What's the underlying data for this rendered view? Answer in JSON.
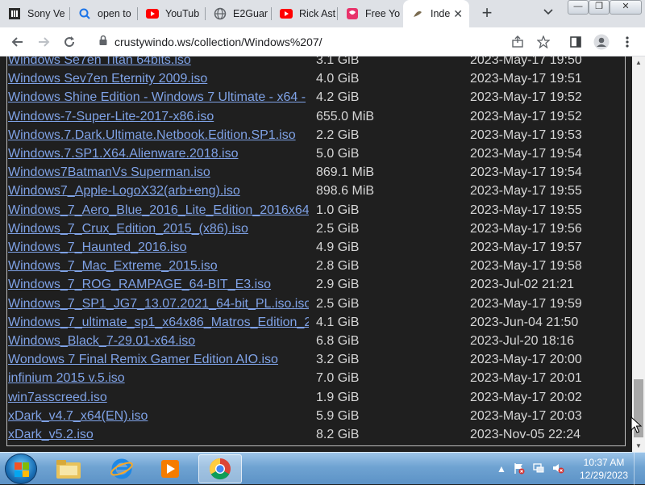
{
  "tabs": [
    {
      "title": "Sony Ve",
      "icon": "sony-icon"
    },
    {
      "title": "open to",
      "icon": "search-icon"
    },
    {
      "title": "YouTub",
      "icon": "youtube-icon"
    },
    {
      "title": "E2Guar",
      "icon": "globe-icon"
    },
    {
      "title": "Rick Ast",
      "icon": "youtube-icon"
    },
    {
      "title": "Free Yo",
      "icon": "freeyo-icon"
    },
    {
      "title": "Inde",
      "icon": "page-icon",
      "active": true
    }
  ],
  "new_tab_label": "+",
  "address_bar": {
    "url": "crustywindo.ws/collection/Windows%207/"
  },
  "files": [
    {
      "name": "Windows Se7en Titan 64bits.iso",
      "size": "3.1 GiB",
      "date": "2023-May-17 19:50"
    },
    {
      "name": "Windows Sev7en Eternity 2009.iso",
      "size": "4.0 GiB",
      "date": "2023-May-17 19:51"
    },
    {
      "name": "Windows Shine Edition - Windows 7 Ultimate - x64 - ",
      "size": "4.2 GiB",
      "date": "2023-May-17 19:52"
    },
    {
      "name": "Windows-7-Super-Lite-2017-x86.iso",
      "size": "655.0 MiB",
      "date": "2023-May-17 19:52"
    },
    {
      "name": "Windows.7.Dark.Ultimate.Netbook.Edition.SP1.iso",
      "size": "2.2 GiB",
      "date": "2023-May-17 19:53"
    },
    {
      "name": "Windows.7.SP1.X64.Alienware.2018.iso",
      "size": "5.0 GiB",
      "date": "2023-May-17 19:54"
    },
    {
      "name": "Windows7BatmanVs Superman.iso",
      "size": "869.1 MiB",
      "date": "2023-May-17 19:54"
    },
    {
      "name": "Windows7_Apple-LogoX32(arb+eng).iso",
      "size": "898.6 MiB",
      "date": "2023-May-17 19:55"
    },
    {
      "name": "Windows_7_Aero_Blue_2016_Lite_Edition_2016x64",
      "size": "1.0 GiB",
      "date": "2023-May-17 19:55"
    },
    {
      "name": "Windows_7_Crux_Edition_2015_(x86).iso",
      "size": "2.5 GiB",
      "date": "2023-May-17 19:56"
    },
    {
      "name": "Windows_7_Haunted_2016.iso",
      "size": "4.9 GiB",
      "date": "2023-May-17 19:57"
    },
    {
      "name": "Windows_7_Mac_Extreme_2015.iso",
      "size": "2.8 GiB",
      "date": "2023-May-17 19:58"
    },
    {
      "name": "Windows_7_ROG_RAMPAGE_64-BIT_E3.iso",
      "size": "2.9 GiB",
      "date": "2023-Jul-02 21:21"
    },
    {
      "name": "Windows_7_SP1_JG7_13.07.2021_64-bit_PL.iso.iso",
      "size": "2.5 GiB",
      "date": "2023-May-17 19:59"
    },
    {
      "name": "Windows_7_ultimate_sp1_x64x86_Matros_Edition_2",
      "size": "4.1 GiB",
      "date": "2023-Jun-04 21:50"
    },
    {
      "name": "Windows_Black_7-29.01-x64.iso",
      "size": "6.8 GiB",
      "date": "2023-Jul-20 18:16"
    },
    {
      "name": "Wondows 7 Final Remix Gamer Edition AIO.iso",
      "size": "3.2 GiB",
      "date": "2023-May-17 20:00"
    },
    {
      "name": "infinium 2015 v.5.iso",
      "size": "7.0 GiB",
      "date": "2023-May-17 20:01"
    },
    {
      "name": "win7asscreed.iso",
      "size": "1.9 GiB",
      "date": "2023-May-17 20:02"
    },
    {
      "name": "xDark_v4.7_x64(EN).iso",
      "size": "5.9 GiB",
      "date": "2023-May-17 20:03"
    },
    {
      "name": "xDark_v5.2.iso",
      "size": "8.2 GiB",
      "date": "2023-Nov-05 22:24"
    }
  ],
  "taskbar": {
    "clock_time": "10:37 AM",
    "clock_date": "12/29/2023"
  },
  "colors": {
    "page_bg": "#1f1f1f",
    "link": "#7fa2e6",
    "text": "#d6d6d6",
    "taskbar": "#6fa3d2"
  }
}
